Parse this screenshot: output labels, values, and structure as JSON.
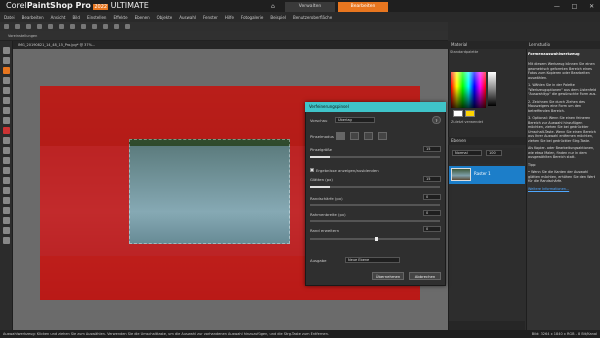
{
  "app": {
    "title_prefix": "Corel",
    "title_main": "PaintShop Pro",
    "title_year": "2022",
    "title_suffix": "ULTIMATE",
    "home_icon": "home-icon",
    "tabs": [
      {
        "label": "Verwalten"
      },
      {
        "label": "Bearbeiten"
      }
    ],
    "window_controls": [
      "—",
      "□",
      "✕"
    ]
  },
  "menubar": {
    "items": [
      {
        "label": "Datei"
      },
      {
        "label": "Bearbeiten"
      },
      {
        "label": "Ansicht"
      },
      {
        "label": "Bild"
      },
      {
        "label": "Einstellen"
      },
      {
        "label": "Effekte"
      },
      {
        "label": "Ebenen"
      },
      {
        "label": "Objekte"
      },
      {
        "label": "Auswahl"
      },
      {
        "label": "Fenster"
      },
      {
        "label": "Hilfe"
      },
      {
        "label": "Fotogalerie"
      },
      {
        "label": "Beispiel"
      },
      {
        "label": "Benutzeroberfläche"
      }
    ]
  },
  "optbar": {
    "label": "Voreinstellungen"
  },
  "document": {
    "tab_label": "IMG_20190821_14_48_15_Pro.jpg* @ 37%..."
  },
  "materials": {
    "header": "Material",
    "tabs_label": "Standardpalette",
    "transparent_label": "Zuletzt verwendet",
    "fg_color": "#ffffff",
    "bg_color": "#ffd400"
  },
  "layers": {
    "header": "Ebenen",
    "mode_label": "Normal",
    "opacity_label": "100",
    "layer_name": "Raster 1"
  },
  "learning": {
    "header": "Lernstudio",
    "title": "Formenauswahlwerkzeug",
    "paragraphs": [
      "Mit diesem Werkzeug können Sie einen geometrisch geformten Bereich eines Fotos zum Kopieren oder Bearbeiten auswählen.",
      "1. Wählen Sie in der Palette \"Werkzeugoptionen\" aus dem Listenfeld \"Auswahltyp\" die gewünschte Form aus.",
      "2. Zeichnen Sie durch Ziehen des Mauszeigers eine Form um den betreffenden Bereich.",
      "3. Optional: Wenn Sie einen feineren Bereich zur Auswahl hinzufügen möchten, ziehen Sie bei gedrückter Umschalt-Taste. Wenn Sie einen Bereich aus Ihrer Auswahl entfernen möchten, ziehen Sie bei gedrückter Strg-Taste.",
      "Als Kopier- oder Bearbeitungsaktionen, wie etwa Malen, finden nur in dem ausgewählten Bereich statt.",
      "Tipp:",
      "• Wenn Sie die Kanten der Auswahl glätten möchten, erhöhen Sie den Wert für die Randschärfe."
    ],
    "link": "Weitere Informationen..."
  },
  "dialog": {
    "title": "Verfeinerungspinsel",
    "preset_label": "Vorschau",
    "preset_value": "Überlag",
    "brush_mode_label": "Pinselmodus",
    "brush_size_label": "Pinselgröße",
    "brush_size_value": "15",
    "checkbox_label": "Ergebnisse anzeigen/ausblenden",
    "smooth_label": "Glätten (px)",
    "smooth_value": "15",
    "edge_label": "Randschärfe (px)",
    "edge_value": "0",
    "contract_label": "Rahmenbreite (px)",
    "contract_value": "0",
    "expand_label": "Rand erweitern",
    "expand_value": "0",
    "output_label": "Ausgabe",
    "output_value": "Neue Ebene",
    "ok_label": "Übernehmen",
    "cancel_label": "Abbrechen",
    "sliders": {
      "brush_size": 0.15,
      "smooth": 0.15,
      "edge": 0.0,
      "contract": 0.0,
      "expand": 0.5
    }
  },
  "status": {
    "left": "Auswahlwerkzeug: Klicken und ziehen Sie zum Auswählen. Verwenden Sie die Umschalttaste, um die Auswahl zur vorhandenen Auswahl hinzuzufügen, und die Strg-Taste zum Entfernen.",
    "right": "Bild: 3264 x 1840 x RGB - 8 Bit/Kanal"
  }
}
